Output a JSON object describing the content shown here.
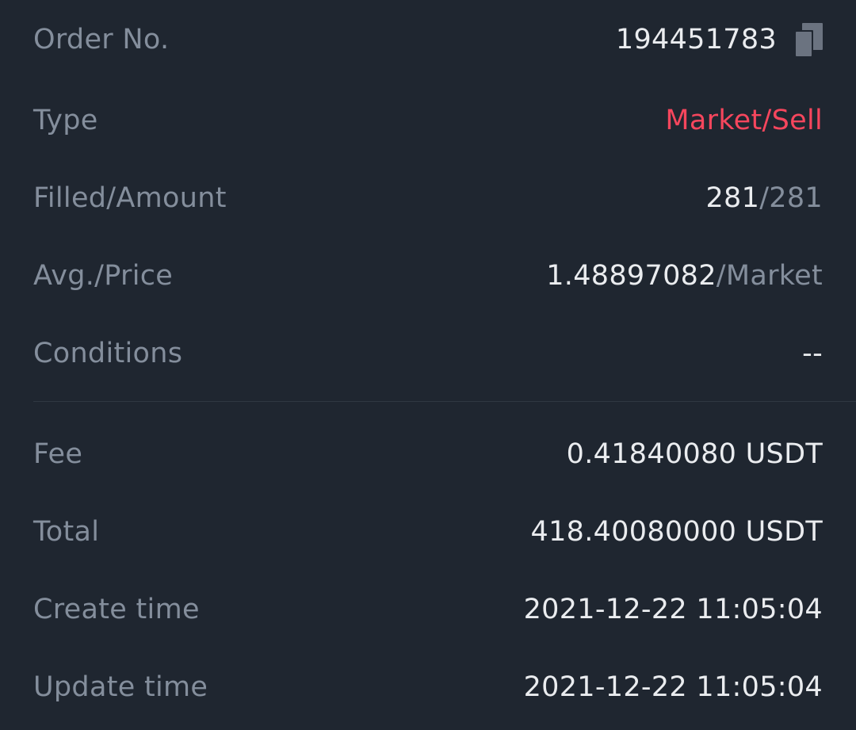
{
  "details": {
    "order_no": {
      "label": "Order No.",
      "value": "194451783"
    },
    "type": {
      "label": "Type",
      "value": "Market/Sell"
    },
    "filled_amount": {
      "label": "Filled/Amount",
      "filled": "281",
      "sep_amount": "/281"
    },
    "avg_price": {
      "label": "Avg./Price",
      "avg": "1.48897082",
      "sep_price": "/Market"
    },
    "conditions": {
      "label": "Conditions",
      "value": "--"
    }
  },
  "summary": {
    "fee": {
      "label": "Fee",
      "value": "0.41840080 USDT"
    },
    "total": {
      "label": "Total",
      "value": "418.40080000 USDT"
    },
    "create_time": {
      "label": "Create time",
      "value": "2021-12-22 11:05:04"
    },
    "update_time": {
      "label": "Update time",
      "value": "2021-12-22 11:05:04"
    }
  },
  "colors": {
    "background": "#1f2630",
    "label": "#848e9c",
    "value": "#eaecef",
    "sell": "#f6465d",
    "divider": "#2f3742"
  },
  "icons": {
    "copy": "copy-icon"
  }
}
